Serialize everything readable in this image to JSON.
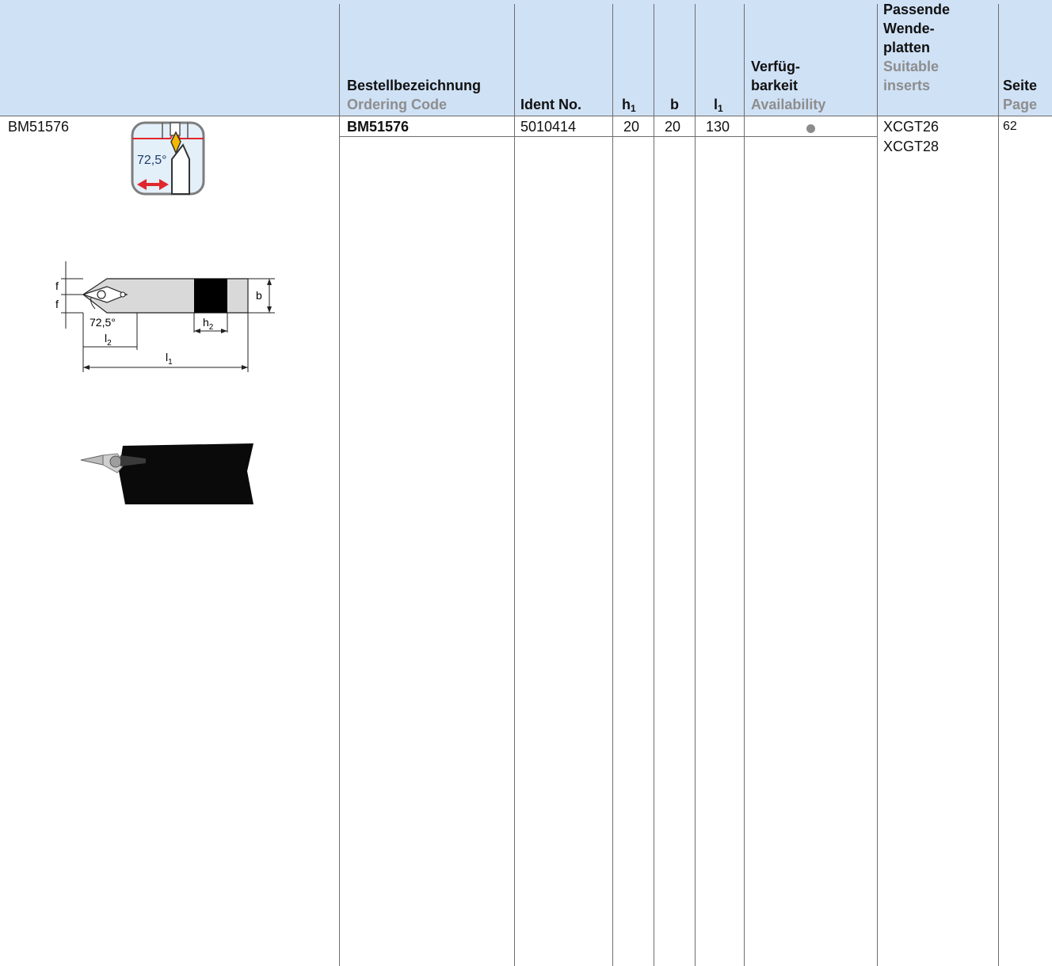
{
  "header": {
    "ordering_de": "Bestellbezeichnung",
    "ordering_en": "Ordering Code",
    "ident": "Ident No.",
    "h1_main": "h",
    "h1_sub": "1",
    "b": "b",
    "l1_main": "l",
    "l1_sub": "1",
    "avail_de_1": "Verfüg-",
    "avail_de_2": "barkeit",
    "avail_en": "Availability",
    "inserts_de_1": "Passende",
    "inserts_de_2": "Wende-",
    "inserts_de_3": "platten",
    "inserts_en_1": "Suitable",
    "inserts_en_2": "inserts",
    "page_de": "Seite",
    "page_en": "Page"
  },
  "row": {
    "label": "BM51576",
    "ordering_code": "BM51576",
    "ident": "5010414",
    "h1": "20",
    "b": "20",
    "l1": "130",
    "availability": "●",
    "inserts": [
      "XCGT26",
      "XCGT28"
    ],
    "page": "62"
  },
  "icon_badge": {
    "angle": "72,5°"
  },
  "drawing": {
    "f_top": "f",
    "f_bottom": "f",
    "b_label": "b",
    "angle": "72,5°",
    "h2_main": "h",
    "h2_sub": "2",
    "l2_main": "l",
    "l2_sub": "2",
    "l1_main": "l",
    "l1_sub": "1"
  },
  "colors": {
    "header_bg": "#cfe1f5",
    "english_text": "#8d8d8d",
    "badge_fill": "#e3eff9",
    "insert_yellow": "#f5b800",
    "arrow_red": "#e0272d"
  }
}
